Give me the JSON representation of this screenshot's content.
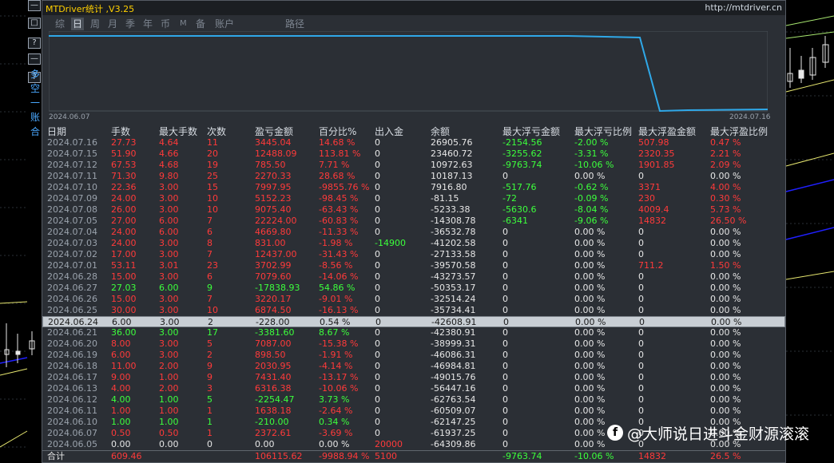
{
  "window": {
    "title": "MTDriver统计 ,V3.25",
    "url": "http://mtdriver.cn"
  },
  "left_toolbar": {
    "buttons": [
      "—",
      "□",
      "?",
      "—",
      "?"
    ],
    "texts": [
      "多",
      "空",
      "一",
      "账",
      "合"
    ]
  },
  "tabs": [
    "综",
    "日",
    "周",
    "月",
    "季",
    "年",
    "币",
    "M",
    "备",
    "账户",
    "路径"
  ],
  "active_tab": "日",
  "equity_chart": {
    "start_label": "2024.06.07",
    "end_label": "2024.07.16"
  },
  "table": {
    "headers": [
      "日期",
      "手数",
      "最大手数",
      "次数",
      "盈亏金额",
      "百分比%",
      "出入金",
      "余额",
      "最大浮亏金额",
      "最大浮亏比例",
      "最大浮盈金额",
      "最大浮盈比例"
    ],
    "rows": [
      {
        "date": "2024.07.16",
        "lots": "27.73",
        "max_lots": "4.64",
        "count": "11",
        "pnl": "3445.04",
        "pct": "14.68 %",
        "flow": "0",
        "balance": "26905.76",
        "max_loss": "-2154.56",
        "max_loss_pct": "-2.00 %",
        "max_profit": "507.98",
        "max_profit_pct": "0.47 %",
        "color": "red"
      },
      {
        "date": "2024.07.15",
        "lots": "51.90",
        "max_lots": "4.66",
        "count": "20",
        "pnl": "12488.09",
        "pct": "113.81 %",
        "flow": "0",
        "balance": "23460.72",
        "max_loss": "-3255.62",
        "max_loss_pct": "-3.31 %",
        "max_profit": "2320.35",
        "max_profit_pct": "2.21 %",
        "color": "red"
      },
      {
        "date": "2024.07.12",
        "lots": "67.53",
        "max_lots": "4.68",
        "count": "19",
        "pnl": "785.50",
        "pct": "7.71 %",
        "flow": "0",
        "balance": "10972.63",
        "max_loss": "-9763.74",
        "max_loss_pct": "-10.06 %",
        "max_profit": "1901.85",
        "max_profit_pct": "2.09 %",
        "color": "red"
      },
      {
        "date": "2024.07.11",
        "lots": "71.30",
        "max_lots": "9.80",
        "count": "25",
        "pnl": "2270.33",
        "pct": "28.68 %",
        "flow": "0",
        "balance": "10187.13",
        "max_loss": "0",
        "max_loss_pct": "0.00 %",
        "max_profit": "0",
        "max_profit_pct": "0.00 %",
        "color": "red"
      },
      {
        "date": "2024.07.10",
        "lots": "22.36",
        "max_lots": "3.00",
        "count": "15",
        "pnl": "7997.95",
        "pct": "-9855.76 %",
        "flow": "0",
        "balance": "7916.80",
        "max_loss": "-517.76",
        "max_loss_pct": "-0.62 %",
        "max_profit": "3371",
        "max_profit_pct": "4.00 %",
        "color": "red"
      },
      {
        "date": "2024.07.09",
        "lots": "24.00",
        "max_lots": "3.00",
        "count": "10",
        "pnl": "5152.23",
        "pct": "-98.45 %",
        "flow": "0",
        "balance": "-81.15",
        "max_loss": "-72",
        "max_loss_pct": "-0.09 %",
        "max_profit": "230",
        "max_profit_pct": "0.30 %",
        "color": "red"
      },
      {
        "date": "2024.07.08",
        "lots": "26.00",
        "max_lots": "3.00",
        "count": "10",
        "pnl": "9075.40",
        "pct": "-63.43 %",
        "flow": "0",
        "balance": "-5233.38",
        "max_loss": "-5630.6",
        "max_loss_pct": "-8.04 %",
        "max_profit": "4009.4",
        "max_profit_pct": "5.73 %",
        "color": "red"
      },
      {
        "date": "2024.07.05",
        "lots": "27.00",
        "max_lots": "6.00",
        "count": "7",
        "pnl": "22224.00",
        "pct": "-60.83 %",
        "flow": "0",
        "balance": "-14308.78",
        "max_loss": "-6341",
        "max_loss_pct": "-9.06 %",
        "max_profit": "14832",
        "max_profit_pct": "26.50 %",
        "color": "red"
      },
      {
        "date": "2024.07.04",
        "lots": "24.00",
        "max_lots": "6.00",
        "count": "6",
        "pnl": "4669.80",
        "pct": "-11.33 %",
        "flow": "0",
        "balance": "-36532.78",
        "max_loss": "0",
        "max_loss_pct": "0.00 %",
        "max_profit": "0",
        "max_profit_pct": "0.00 %",
        "color": "red"
      },
      {
        "date": "2024.07.03",
        "lots": "24.00",
        "max_lots": "3.00",
        "count": "8",
        "pnl": "831.00",
        "pct": "-1.98 %",
        "flow": "-14900",
        "balance": "-41202.58",
        "max_loss": "0",
        "max_loss_pct": "0.00 %",
        "max_profit": "0",
        "max_profit_pct": "0.00 %",
        "color": "red"
      },
      {
        "date": "2024.07.02",
        "lots": "17.00",
        "max_lots": "3.00",
        "count": "7",
        "pnl": "12437.00",
        "pct": "-31.43 %",
        "flow": "0",
        "balance": "-27133.58",
        "max_loss": "0",
        "max_loss_pct": "0.00 %",
        "max_profit": "0",
        "max_profit_pct": "0.00 %",
        "color": "red"
      },
      {
        "date": "2024.07.01",
        "lots": "53.11",
        "max_lots": "3.01",
        "count": "23",
        "pnl": "3702.99",
        "pct": "-8.56 %",
        "flow": "0",
        "balance": "-39570.58",
        "max_loss": "0",
        "max_loss_pct": "0.00 %",
        "max_profit": "711.2",
        "max_profit_pct": "1.50 %",
        "color": "red"
      },
      {
        "date": "2024.06.28",
        "lots": "15.00",
        "max_lots": "3.00",
        "count": "6",
        "pnl": "7079.60",
        "pct": "-14.06 %",
        "flow": "0",
        "balance": "-43273.57",
        "max_loss": "0",
        "max_loss_pct": "0.00 %",
        "max_profit": "0",
        "max_profit_pct": "0.00 %",
        "color": "red"
      },
      {
        "date": "2024.06.27",
        "lots": "27.03",
        "max_lots": "6.00",
        "count": "9",
        "pnl": "-17838.93",
        "pct": "54.86 %",
        "flow": "0",
        "balance": "-50353.17",
        "max_loss": "0",
        "max_loss_pct": "0.00 %",
        "max_profit": "0",
        "max_profit_pct": "0.00 %",
        "color": "green"
      },
      {
        "date": "2024.06.26",
        "lots": "15.00",
        "max_lots": "3.00",
        "count": "7",
        "pnl": "3220.17",
        "pct": "-9.01 %",
        "flow": "0",
        "balance": "-32514.24",
        "max_loss": "0",
        "max_loss_pct": "0.00 %",
        "max_profit": "0",
        "max_profit_pct": "0.00 %",
        "color": "red"
      },
      {
        "date": "2024.06.25",
        "lots": "30.00",
        "max_lots": "3.00",
        "count": "10",
        "pnl": "6874.50",
        "pct": "-16.13 %",
        "flow": "0",
        "balance": "-35734.41",
        "max_loss": "0",
        "max_loss_pct": "0.00 %",
        "max_profit": "0",
        "max_profit_pct": "0.00 %",
        "color": "red"
      },
      {
        "date": "2024.06.24",
        "lots": "6.00",
        "max_lots": "3.00",
        "count": "2",
        "pnl": "-228.00",
        "pct": "0.54 %",
        "flow": "0",
        "balance": "-42608.91",
        "max_loss": "0",
        "max_loss_pct": "0.00 %",
        "max_profit": "0",
        "max_profit_pct": "0.00 %",
        "color": "green"
      },
      {
        "date": "2024.06.21",
        "lots": "36.00",
        "max_lots": "3.00",
        "count": "17",
        "pnl": "-3381.60",
        "pct": "8.67 %",
        "flow": "0",
        "balance": "-42380.91",
        "max_loss": "0",
        "max_loss_pct": "0.00 %",
        "max_profit": "0",
        "max_profit_pct": "0.00 %",
        "color": "green"
      },
      {
        "date": "2024.06.20",
        "lots": "8.00",
        "max_lots": "3.00",
        "count": "5",
        "pnl": "7087.00",
        "pct": "-15.38 %",
        "flow": "0",
        "balance": "-38999.31",
        "max_loss": "0",
        "max_loss_pct": "0.00 %",
        "max_profit": "0",
        "max_profit_pct": "0.00 %",
        "color": "red"
      },
      {
        "date": "2024.06.19",
        "lots": "6.00",
        "max_lots": "3.00",
        "count": "2",
        "pnl": "898.50",
        "pct": "-1.91 %",
        "flow": "0",
        "balance": "-46086.31",
        "max_loss": "0",
        "max_loss_pct": "0.00 %",
        "max_profit": "0",
        "max_profit_pct": "0.00 %",
        "color": "red"
      },
      {
        "date": "2024.06.18",
        "lots": "11.00",
        "max_lots": "2.00",
        "count": "9",
        "pnl": "2030.95",
        "pct": "-4.14 %",
        "flow": "0",
        "balance": "-46984.81",
        "max_loss": "0",
        "max_loss_pct": "0.00 %",
        "max_profit": "0",
        "max_profit_pct": "0.00 %",
        "color": "red"
      },
      {
        "date": "2024.06.17",
        "lots": "9.00",
        "max_lots": "1.00",
        "count": "9",
        "pnl": "7431.40",
        "pct": "-13.17 %",
        "flow": "0",
        "balance": "-49015.76",
        "max_loss": "0",
        "max_loss_pct": "0.00 %",
        "max_profit": "0",
        "max_profit_pct": "0.00 %",
        "color": "red"
      },
      {
        "date": "2024.06.13",
        "lots": "4.00",
        "max_lots": "2.00",
        "count": "3",
        "pnl": "6316.38",
        "pct": "-10.06 %",
        "flow": "0",
        "balance": "-56447.16",
        "max_loss": "0",
        "max_loss_pct": "0.00 %",
        "max_profit": "0",
        "max_profit_pct": "0.00 %",
        "color": "red"
      },
      {
        "date": "2024.06.12",
        "lots": "4.00",
        "max_lots": "1.00",
        "count": "5",
        "pnl": "-2254.47",
        "pct": "3.73 %",
        "flow": "0",
        "balance": "-62763.54",
        "max_loss": "0",
        "max_loss_pct": "0.00 %",
        "max_profit": "0",
        "max_profit_pct": "0.00 %",
        "color": "green"
      },
      {
        "date": "2024.06.11",
        "lots": "1.00",
        "max_lots": "1.00",
        "count": "1",
        "pnl": "1638.18",
        "pct": "-2.64 %",
        "flow": "0",
        "balance": "-60509.07",
        "max_loss": "0",
        "max_loss_pct": "0.00 %",
        "max_profit": "0",
        "max_profit_pct": "0.00 %",
        "color": "red"
      },
      {
        "date": "2024.06.10",
        "lots": "1.00",
        "max_lots": "1.00",
        "count": "1",
        "pnl": "-210.00",
        "pct": "0.34 %",
        "flow": "0",
        "balance": "-62147.25",
        "max_loss": "0",
        "max_loss_pct": "0.00 %",
        "max_profit": "0",
        "max_profit_pct": "0.00 %",
        "color": "green"
      },
      {
        "date": "2024.06.07",
        "lots": "0.50",
        "max_lots": "0.50",
        "count": "1",
        "pnl": "2372.61",
        "pct": "-3.69 %",
        "flow": "0",
        "balance": "-61937.25",
        "max_loss": "0",
        "max_loss_pct": "0.00 %",
        "max_profit": "0",
        "max_profit_pct": "0.00 %",
        "color": "red"
      },
      {
        "date": "2024.06.05",
        "lots": "0.00",
        "max_lots": "0.00",
        "count": "0",
        "pnl": "0.00",
        "pct": "0.00 %",
        "flow": "20000",
        "balance": "-64309.86",
        "max_loss": "0",
        "max_loss_pct": "0.00 %",
        "max_profit": "0",
        "max_profit_pct": "0.00 %",
        "color": "white"
      }
    ],
    "selected_index": 16,
    "total": {
      "label": "合计",
      "lots": "609.46",
      "pnl": "106115.62",
      "pct": "-9988.94 %",
      "flow": "5100",
      "max_loss": "-9763.74",
      "max_loss_pct": "-10.06 %",
      "max_profit": "14832",
      "max_profit_pct": "26.5 %"
    }
  },
  "watermark": "@大师说日进斗金财源滚滚",
  "colors": {
    "red": "#ff3a3a",
    "green": "#3cff3c",
    "line": "#2fa8e8"
  }
}
